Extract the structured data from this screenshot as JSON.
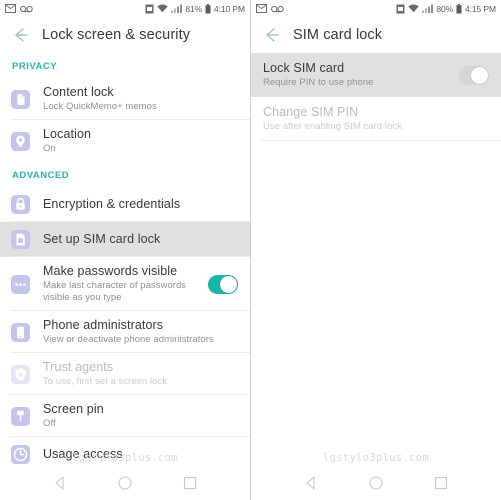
{
  "left": {
    "status_bar": {
      "icons_left": [
        "message-icon",
        "voicemail-icon"
      ],
      "icons_right": [
        "sim-icon",
        "wifi-icon",
        "signal-icon"
      ],
      "battery_percent": "81%",
      "battery_icon": "battery-icon",
      "time": "4:10 PM"
    },
    "app_bar": {
      "back_icon": "back-arrow-icon",
      "title": "Lock screen & security"
    },
    "sections": [
      {
        "header": "PRIVACY",
        "items": [
          {
            "icon": "document-icon",
            "title": "Content lock",
            "subtitle": "Lock QuickMemo+ memos",
            "state": "normal",
            "toggle": null
          },
          {
            "icon": "location-pin-icon",
            "title": "Location",
            "subtitle": "On",
            "state": "normal",
            "toggle": null
          }
        ]
      },
      {
        "header": "ADVANCED",
        "items": [
          {
            "icon": "lock-icon",
            "title": "Encryption & credentials",
            "subtitle": "",
            "state": "normal",
            "toggle": null
          },
          {
            "icon": "sim-card-icon",
            "title": "Set up SIM card lock",
            "subtitle": "",
            "state": "selected",
            "toggle": null
          },
          {
            "icon": "password-dots-icon",
            "title": "Make passwords visible",
            "subtitle": "Make last character of passwords visible as you type",
            "state": "normal",
            "toggle": "on"
          },
          {
            "icon": "phone-icon",
            "title": "Phone administrators",
            "subtitle": "View or deactivate phone administrators",
            "state": "normal",
            "toggle": null
          },
          {
            "icon": "trust-agent-icon",
            "title": "Trust agents",
            "subtitle": "To use, first set a screen lock",
            "state": "disabled",
            "toggle": null
          },
          {
            "icon": "screen-pin-icon",
            "title": "Screen pin",
            "subtitle": "Off",
            "state": "normal",
            "toggle": null
          },
          {
            "icon": "clock-icon",
            "title": "Usage access",
            "subtitle": "",
            "state": "normal",
            "toggle": null
          }
        ]
      }
    ],
    "watermark": "lgstylo3plus.com",
    "nav_bar": [
      "back-nav-icon",
      "home-nav-icon",
      "recents-nav-icon"
    ]
  },
  "right": {
    "status_bar": {
      "icons_left": [
        "message-icon",
        "voicemail-icon"
      ],
      "icons_right": [
        "sim-icon",
        "wifi-icon",
        "signal-icon"
      ],
      "battery_percent": "80%",
      "battery_icon": "battery-icon",
      "time": "4:15 PM"
    },
    "app_bar": {
      "back_icon": "back-arrow-icon",
      "title": "SIM card lock"
    },
    "items": [
      {
        "title": "Lock SIM card",
        "subtitle": "Require PIN to use phone",
        "state": "selected",
        "toggle": "off"
      },
      {
        "title": "Change SIM PIN",
        "subtitle": "Use after enabling SIM card lock",
        "state": "disabled",
        "toggle": null
      }
    ],
    "watermark": "lgstylo3plus.com",
    "nav_bar": [
      "back-nav-icon",
      "home-nav-icon",
      "recents-nav-icon"
    ]
  },
  "colors": {
    "section_header": "#2bb3b0",
    "toggle_on": "#19b5ab",
    "toggle_off": "#d6d6d6",
    "selected_row": "#e0e0e0",
    "icon_tint": "#a6a9df",
    "title_text": "#35393c",
    "subtitle_text": "#8d9194"
  }
}
